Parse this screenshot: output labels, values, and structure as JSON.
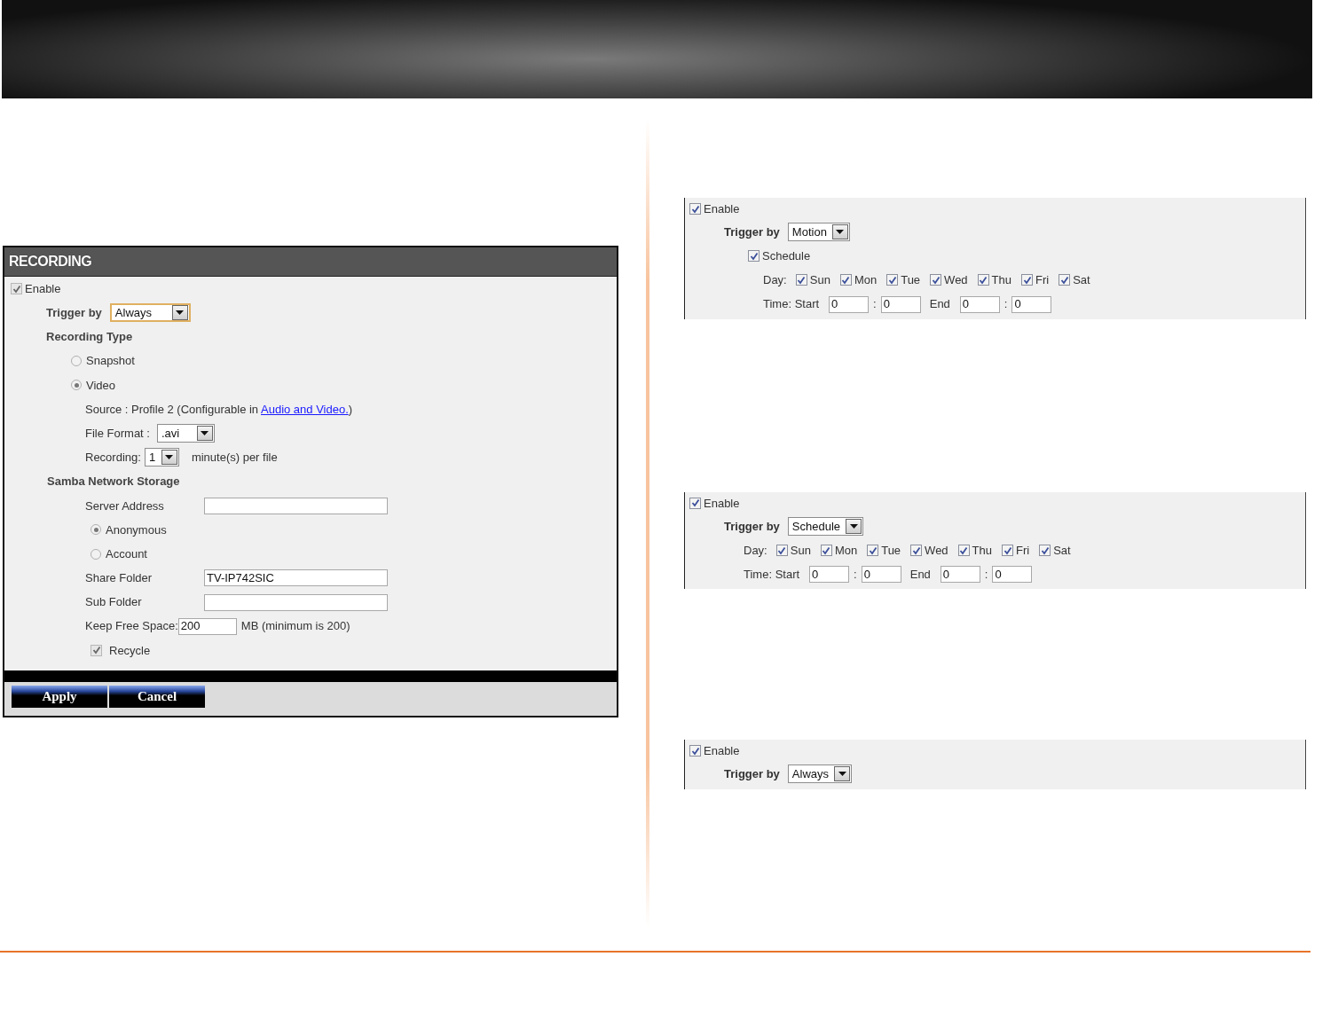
{
  "recording_panel": {
    "title": "RECORDING",
    "enable": {
      "label": "Enable",
      "checked": true
    },
    "trigger": {
      "label": "Trigger by",
      "value": "Always"
    },
    "recording_type": {
      "label": "Recording Type",
      "options": [
        {
          "label": "Snapshot",
          "selected": false
        },
        {
          "label": "Video",
          "selected": true
        }
      ]
    },
    "source": {
      "text": "Source : Profile 2  (Configurable in",
      "link": "Audio and Video.",
      "suffix": ")"
    },
    "file_format": {
      "label": "File Format :",
      "value": ".avi"
    },
    "recording": {
      "label": "Recording:",
      "value": "1",
      "suffix": "minute(s) per file"
    },
    "samba": {
      "label": "Samba Network Storage",
      "server_address": {
        "label": "Server Address"
      },
      "auth": [
        {
          "label": "Anonymous",
          "selected": true
        },
        {
          "label": "Account",
          "selected": false
        }
      ],
      "share_folder": {
        "label": "Share Folder",
        "value": "TV-IP742SIC"
      },
      "sub_folder": {
        "label": "Sub Folder"
      },
      "keep_free": {
        "label": "Keep Free Space:",
        "value": "200",
        "suffix": "MB (minimum is 200)"
      },
      "recycle": {
        "label": "Recycle",
        "checked": true
      }
    },
    "buttons": [
      "Apply",
      "Cancel"
    ]
  },
  "trigger_panels": [
    {
      "enable": {
        "label": "Enable",
        "checked": true
      },
      "trigger": {
        "label": "Trigger by",
        "value": "Motion"
      },
      "schedule": {
        "label": "Schedule",
        "checked": true
      },
      "days": {
        "label": "Day:",
        "items": [
          {
            "label": "Sun",
            "checked": true
          },
          {
            "label": "Mon",
            "checked": true
          },
          {
            "label": "Tue",
            "checked": true
          },
          {
            "label": "Wed",
            "checked": true
          },
          {
            "label": "Thu",
            "checked": true
          },
          {
            "label": "Fri",
            "checked": true
          },
          {
            "label": "Sat",
            "checked": true
          }
        ]
      },
      "time": {
        "label": "Time: Start",
        "start": [
          "0",
          "0"
        ],
        "end_label": "End",
        "end": [
          "0",
          "0"
        ],
        "separators": [
          ":",
          ":"
        ]
      }
    },
    {
      "enable": {
        "label": "Enable",
        "checked": true
      },
      "trigger": {
        "label": "Trigger by",
        "value": "Schedule"
      },
      "days": {
        "label": "Day:",
        "items": [
          {
            "label": "Sun",
            "checked": true
          },
          {
            "label": "Mon",
            "checked": true
          },
          {
            "label": "Tue",
            "checked": true
          },
          {
            "label": "Wed",
            "checked": true
          },
          {
            "label": "Thu",
            "checked": true
          },
          {
            "label": "Fri",
            "checked": true
          },
          {
            "label": "Sat",
            "checked": true
          }
        ]
      },
      "time": {
        "label": "Time: Start",
        "start": [
          "0",
          "0"
        ],
        "end_label": "End",
        "end": [
          "0",
          "0"
        ],
        "separators": [
          ":",
          ":"
        ]
      }
    },
    {
      "enable": {
        "label": "Enable",
        "checked": true
      },
      "trigger": {
        "label": "Trigger by",
        "value": "Always"
      }
    }
  ]
}
